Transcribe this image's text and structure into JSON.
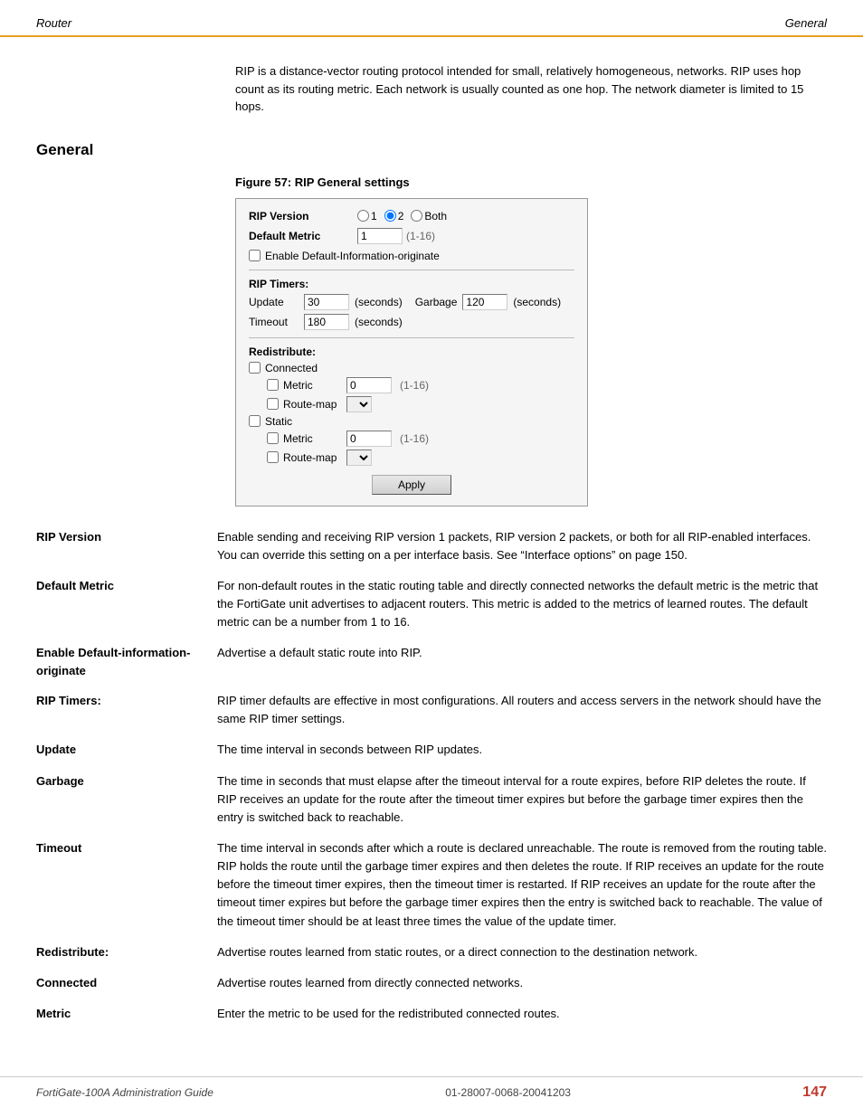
{
  "header": {
    "left": "Router",
    "right": "General"
  },
  "intro": {
    "text": "RIP is a distance-vector routing protocol intended for small, relatively homogeneous, networks. RIP uses hop count as its routing metric. Each network is usually counted as one hop. The network diameter is limited to 15 hops."
  },
  "section": {
    "title": "General"
  },
  "figure": {
    "caption": "Figure 57: RIP General settings",
    "rip_version_label": "RIP Version",
    "rip_version_options": [
      "1",
      "2",
      "Both"
    ],
    "rip_version_selected": "2",
    "default_metric_label": "Default Metric",
    "default_metric_value": "1",
    "default_metric_range": "(1-16)",
    "enable_default_label": "Enable Default-Information-originate",
    "rip_timers_label": "RIP Timers:",
    "update_label": "Update",
    "update_value": "30",
    "update_unit": "(seconds)",
    "garbage_label": "Garbage",
    "garbage_value": "120",
    "garbage_unit": "(seconds)",
    "timeout_label": "Timeout",
    "timeout_value": "180",
    "timeout_unit": "(seconds)",
    "redistribute_label": "Redistribute:",
    "connected_label": "Connected",
    "metric_label": "Metric",
    "metric_value_connected": "0",
    "metric_range_connected": "(1-16)",
    "route_map_label": "Route-map",
    "static_label": "Static",
    "metric_value_static": "0",
    "metric_range_static": "(1-16)",
    "apply_button": "Apply"
  },
  "definitions": [
    {
      "term": "RIP Version",
      "desc": "Enable sending and receiving RIP version 1 packets, RIP version 2 packets, or both for all RIP-enabled interfaces. You can override this setting on a per interface basis. See “Interface options” on page 150.",
      "has_link": true,
      "link_text": "\"Interface options\" on page 150"
    },
    {
      "term": "Default Metric",
      "desc": "For non-default routes in the static routing table and directly connected networks the default metric is the metric that the FortiGate unit advertises to adjacent routers. This metric is added to the metrics of learned routes. The default metric can be a number from 1 to 16."
    },
    {
      "term": "Enable Default-information-originate",
      "desc": "Advertise a default static route into RIP."
    },
    {
      "term": "RIP Timers:",
      "desc": "RIP timer defaults are effective in most configurations. All routers and access servers in the network should have the same RIP timer settings."
    },
    {
      "term": "Update",
      "desc": "The time interval in seconds between RIP updates."
    },
    {
      "term": "Garbage",
      "desc": "The time in seconds that must elapse after the timeout interval for a route expires, before RIP deletes the route. If RIP receives an update for the route after the timeout timer expires but before the garbage timer expires then the entry is switched back to reachable."
    },
    {
      "term": "Timeout",
      "desc": "The time interval in seconds after which a route is declared unreachable. The route is removed from the routing table. RIP holds the route until the garbage timer expires and then deletes the route. If RIP receives an update for the route before the timeout timer expires, then the timeout timer is restarted. If RIP receives an update for the route after the timeout timer expires but before the garbage timer expires then the entry is switched back to reachable. The value of the timeout timer should be at least three times the value of the update timer."
    },
    {
      "term": "Redistribute:",
      "desc": "Advertise routes learned from static routes, or a direct connection to the destination network."
    },
    {
      "term": "Connected",
      "desc": "Advertise routes learned from directly connected networks."
    },
    {
      "term": "Metric",
      "desc": "Enter the metric to be used for the redistributed connected routes."
    }
  ],
  "footer": {
    "left": "FortiGate-100A Administration Guide",
    "center": "01-28007-0068-20041203",
    "right": "147"
  }
}
